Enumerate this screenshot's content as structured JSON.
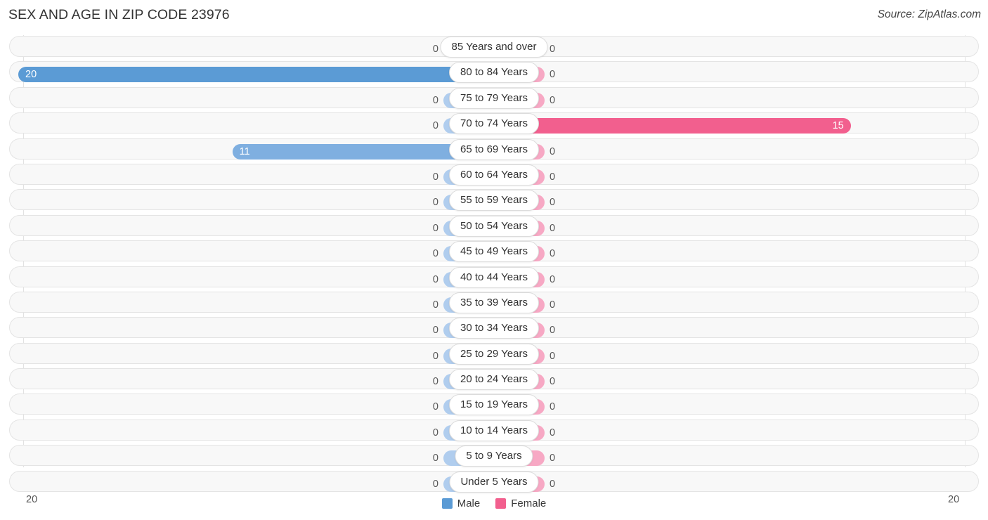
{
  "header": {
    "title": "SEX AND AGE IN ZIP CODE 23976",
    "source": "Source: ZipAtlas.com"
  },
  "legend": {
    "male_label": "Male",
    "female_label": "Female",
    "male_color": "#5b9bd5",
    "female_color": "#f25f8e"
  },
  "axis": {
    "left_max": "20",
    "right_max": "20"
  },
  "chart_data": {
    "type": "bar",
    "title": "SEX AND AGE IN ZIP CODE 23976",
    "subtitle": "Source: ZipAtlas.com",
    "orientation": "horizontal-diverging",
    "xlabel": "",
    "ylabel": "",
    "xlim": [
      20,
      20
    ],
    "axis_tick_labels": {
      "left": "20",
      "right": "20"
    },
    "grid": false,
    "legend_position": "bottom-center",
    "categories": [
      "85 Years and over",
      "80 to 84 Years",
      "75 to 79 Years",
      "70 to 74 Years",
      "65 to 69 Years",
      "60 to 64 Years",
      "55 to 59 Years",
      "50 to 54 Years",
      "45 to 49 Years",
      "40 to 44 Years",
      "35 to 39 Years",
      "30 to 34 Years",
      "25 to 29 Years",
      "20 to 24 Years",
      "15 to 19 Years",
      "10 to 14 Years",
      "5 to 9 Years",
      "Under 5 Years"
    ],
    "series": [
      {
        "name": "Male",
        "color": "#5b9bd5",
        "values": [
          0,
          20,
          0,
          0,
          11,
          0,
          0,
          0,
          0,
          0,
          0,
          0,
          0,
          0,
          0,
          0,
          0,
          0
        ]
      },
      {
        "name": "Female",
        "color": "#f25f8e",
        "values": [
          0,
          0,
          0,
          15,
          0,
          0,
          0,
          0,
          0,
          0,
          0,
          0,
          0,
          0,
          0,
          0,
          0,
          0
        ]
      }
    ]
  },
  "rows": [
    {
      "label": "85 Years and over",
      "male": "0",
      "female": "0"
    },
    {
      "label": "80 to 84 Years",
      "male": "20",
      "female": "0"
    },
    {
      "label": "75 to 79 Years",
      "male": "0",
      "female": "0"
    },
    {
      "label": "70 to 74 Years",
      "male": "0",
      "female": "15"
    },
    {
      "label": "65 to 69 Years",
      "male": "11",
      "female": "0"
    },
    {
      "label": "60 to 64 Years",
      "male": "0",
      "female": "0"
    },
    {
      "label": "55 to 59 Years",
      "male": "0",
      "female": "0"
    },
    {
      "label": "50 to 54 Years",
      "male": "0",
      "female": "0"
    },
    {
      "label": "45 to 49 Years",
      "male": "0",
      "female": "0"
    },
    {
      "label": "40 to 44 Years",
      "male": "0",
      "female": "0"
    },
    {
      "label": "35 to 39 Years",
      "male": "0",
      "female": "0"
    },
    {
      "label": "30 to 34 Years",
      "male": "0",
      "female": "0"
    },
    {
      "label": "25 to 29 Years",
      "male": "0",
      "female": "0"
    },
    {
      "label": "20 to 24 Years",
      "male": "0",
      "female": "0"
    },
    {
      "label": "15 to 19 Years",
      "male": "0",
      "female": "0"
    },
    {
      "label": "10 to 14 Years",
      "male": "0",
      "female": "0"
    },
    {
      "label": "5 to 9 Years",
      "male": "0",
      "female": "0"
    },
    {
      "label": "Under 5 Years",
      "male": "0",
      "female": "0"
    }
  ]
}
